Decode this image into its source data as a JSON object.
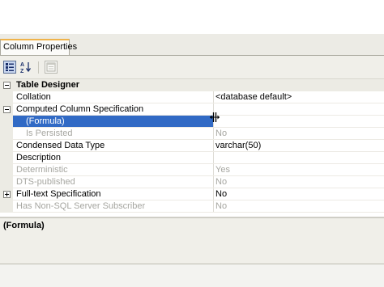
{
  "panel": {
    "tab_label": "Column Properties"
  },
  "toolbar": {
    "categorized_icon": "categorized-icon",
    "alphabetical_icon": "alphabetical-sort-icon",
    "property_pages_icon": "property-pages-icon"
  },
  "grid": {
    "categories": {
      "table_designer": "Table Designer",
      "computed_column": "Computed Column Specification",
      "fulltext": "Full-text Specification"
    },
    "rows": {
      "collation": {
        "name": "Collation",
        "value": "<database default>"
      },
      "formula": {
        "name": "(Formula)",
        "value": ""
      },
      "is_persisted": {
        "name": "Is Persisted",
        "value": "No"
      },
      "condensed_type": {
        "name": "Condensed Data Type",
        "value": "varchar(50)"
      },
      "description": {
        "name": "Description",
        "value": ""
      },
      "deterministic": {
        "name": "Deterministic",
        "value": "Yes"
      },
      "dts_published": {
        "name": "DTS-published",
        "value": "No"
      },
      "fulltext_value": "No",
      "non_sql_subscriber": {
        "name": "Has Non-SQL Server Subscriber",
        "value": "No"
      }
    }
  },
  "description_pane": {
    "title": "(Formula)"
  },
  "colors": {
    "selection": "#316ac5",
    "tab_accent": "#f0b34a",
    "category_bg": "#ecebe4",
    "disabled_text": "#a6a6a0"
  }
}
